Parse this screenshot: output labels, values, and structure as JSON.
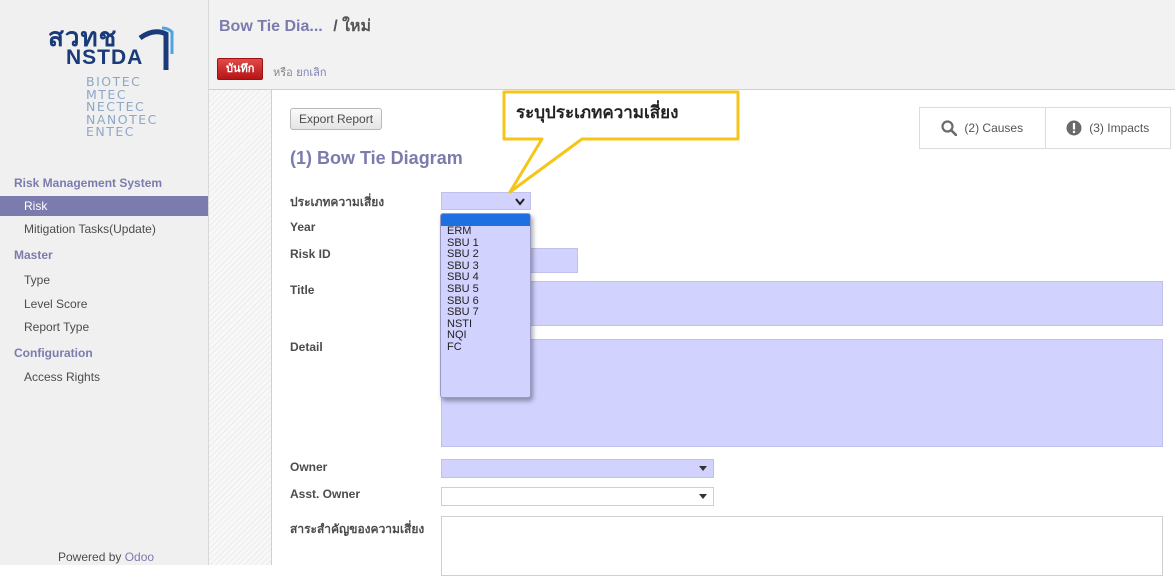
{
  "sidebar": {
    "logo": {
      "brand_line1": "สวทช",
      "brand_line2": "NSTDA",
      "orgs": [
        "BIOTEC",
        "MTEC",
        "NECTEC",
        "NANOTEC",
        "ENTEC"
      ]
    },
    "section_risk_mgmt": "Risk Management System",
    "items_risk": [
      {
        "label": "Risk",
        "active": true
      },
      {
        "label": "Mitigation Tasks(Update)",
        "active": false
      }
    ],
    "section_master": "Master",
    "items_master": [
      {
        "label": "Type"
      },
      {
        "label": "Level Score"
      },
      {
        "label": "Report Type"
      }
    ],
    "section_config": "Configuration",
    "items_config": [
      {
        "label": "Access Rights"
      }
    ],
    "powered_prefix": "Powered by",
    "powered_brand": "Odoo"
  },
  "header": {
    "breadcrumb_parent": "Bow Tie Dia...",
    "breadcrumb_current": "/ ใหม่",
    "save_label": "บันทึก",
    "or_label": "หรือ",
    "cancel_label": "ยกเลิก"
  },
  "form": {
    "export_label": "Export Report",
    "title": "(1) Bow Tie Diagram",
    "smart_buttons": [
      {
        "label": "(2) Causes",
        "icon": "search-icon"
      },
      {
        "label": "(3) Impacts",
        "icon": "exclamation-icon"
      }
    ],
    "fields": {
      "risk_type": "ประเภทความเสี่ยง",
      "year": "Year",
      "risk_id": "Risk ID",
      "title": "Title",
      "detail": "Detail",
      "owner": "Owner",
      "asst_owner": "Asst. Owner",
      "risk_essence": "สาระสำคัญของความเสี่ยง"
    },
    "risk_type_options": [
      "",
      "ERM",
      "SBU 1",
      "SBU 2",
      "SBU 3",
      "SBU 4",
      "SBU 5",
      "SBU 6",
      "SBU 7",
      "NSTI",
      "NQI",
      "FC"
    ]
  },
  "callout": {
    "text": "ระบุประเภทความเสี่ยง",
    "border_color": "#f5c518"
  },
  "colors": {
    "accent": "#7c7bad",
    "field_bg": "#d2d2ff",
    "save_red": "#c62828",
    "selected_option": "#1e70e0"
  }
}
